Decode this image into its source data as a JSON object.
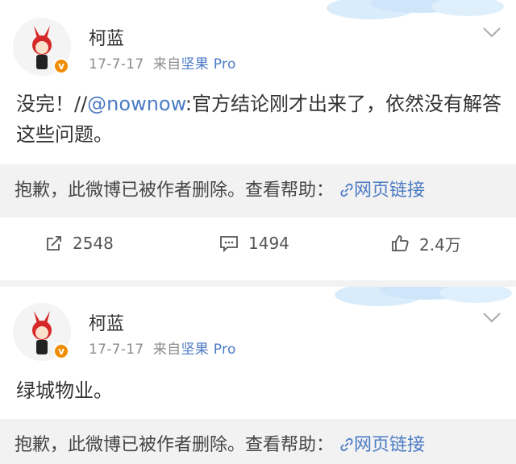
{
  "posts": [
    {
      "author": "柯蓝",
      "date": "17-7-17",
      "source_prefix": "来自",
      "source_app": "坚果 Pro",
      "text_main": "没完！//",
      "mention": "@nownow",
      "text_rest": ":官方结论刚才出来了，依然没有解答这些问题。",
      "deleted_notice": "抱歉，此微博已被作者删除。查看帮助：",
      "help_link": "网页链接",
      "actions": {
        "repost": "2548",
        "comment": "1494",
        "like": "2.4万"
      }
    },
    {
      "author": "柯蓝",
      "date": "17-7-17",
      "source_prefix": "来自",
      "source_app": "坚果 Pro",
      "text_main": "绿城物业。",
      "deleted_notice": "抱歉，此微博已被作者删除。查看帮助：",
      "help_link": "网页链接"
    }
  ],
  "icons": {
    "avatar": "red-bunny-avatar",
    "verified": "verified-badge-icon",
    "chevron": "chevron-down-icon",
    "repost": "repost-icon",
    "comment": "comment-icon",
    "like": "thumbs-up-icon",
    "link": "link-icon"
  },
  "colors": {
    "link_blue": "#4b7bc4",
    "verified_orange": "#f08c00",
    "meta_gray": "#8c8c8c",
    "background": "#f2f2f2"
  }
}
